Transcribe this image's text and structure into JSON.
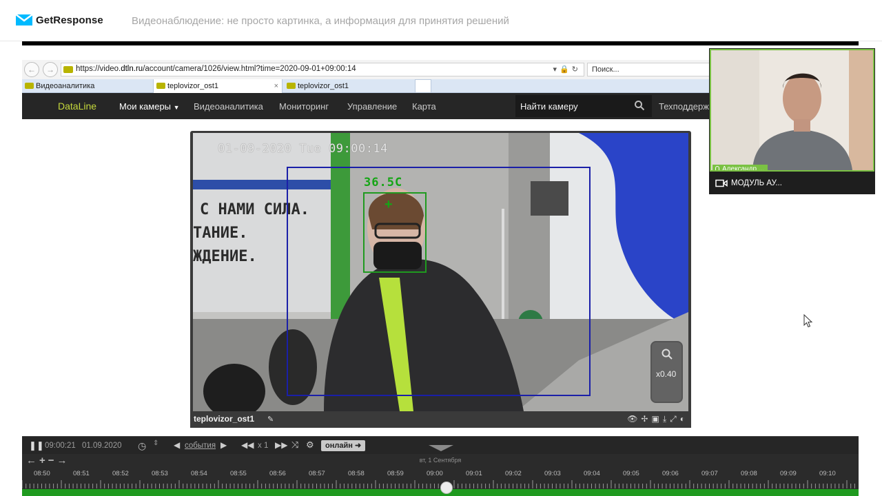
{
  "app": {
    "brand": "GetResponse",
    "webinar_title": "Видеонаблюдение: не просто картинка, а информация для принятия решений"
  },
  "browser": {
    "url_prefix": "https://video.",
    "url_domain": "dtln.ru",
    "url_path": "/account/camera/1026/view.html?time=2020-09-01+09:00:14",
    "search_placeholder": "Поиск...",
    "tabs": [
      {
        "label": "Видеоаналитика",
        "active": false
      },
      {
        "label": "teplovizor_ost1",
        "active": true
      },
      {
        "label": "teplovizor_ost1",
        "active": false
      }
    ]
  },
  "portal_nav": {
    "logo": "DataLine",
    "items": [
      "Мои камеры",
      "Видеоаналитика",
      "Мониторинг",
      "Управление",
      "Карта"
    ],
    "find_camera": "Найти камеру",
    "support": "Техподдержка"
  },
  "camera": {
    "name": "teplovizor_ost1",
    "osd_timestamp": "01-09-2020 Tue 09:00:14",
    "temperature": "36.5C",
    "zoom": "x0.40",
    "wall_text": [
      "С НАМИ СИЛА.",
      "ТАНИЕ.",
      "ЖДЕНИЕ."
    ]
  },
  "timeline": {
    "current_time": "09:00:21",
    "current_date": "01.09.2020",
    "events_link": "события",
    "speed": "x 1",
    "online_button": "онлайн",
    "day_label": "вт, 1 Сентября",
    "ticks": [
      "08:50",
      "08:51",
      "08:52",
      "08:53",
      "08:54",
      "08:55",
      "08:56",
      "08:57",
      "08:58",
      "08:59",
      "09:00",
      "09:01",
      "09:02",
      "09:03",
      "09:04",
      "09:05",
      "09:06",
      "09:07",
      "09:08",
      "09:09",
      "09:10"
    ],
    "playhead_fraction": 0.5
  },
  "participant": {
    "name": "Александр ...",
    "module_label": "МОДУЛЬ АУ..."
  },
  "colors": {
    "accent_green": "#7ac143",
    "timeline_green": "#1f9a1f",
    "detection_blue": "#1a1fa8",
    "dataline_logo": "#c6d93c"
  },
  "icons": [
    "getresponse-logo-icon",
    "back-icon",
    "forward-icon",
    "lock-icon",
    "refresh-icon",
    "search-icon",
    "pause-icon",
    "clock-icon",
    "prev-event-icon",
    "next-event-icon",
    "rewind-icon",
    "fast-forward-icon",
    "shuffle-icon",
    "settings-icon",
    "eye-icon",
    "move-icon",
    "image-icon",
    "download-icon",
    "fullscreen-icon",
    "palette-icon",
    "zoom-icon",
    "mic-icon",
    "camera-icon",
    "cursor-icon"
  ]
}
